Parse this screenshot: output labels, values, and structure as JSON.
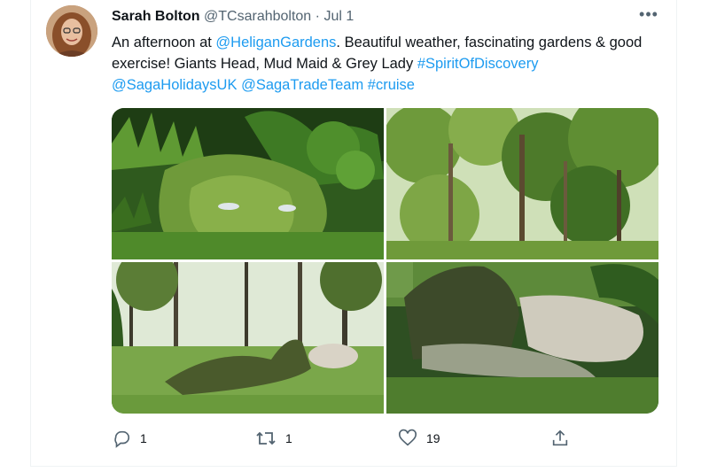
{
  "tweet": {
    "author_name": "Sarah Bolton",
    "author_handle": "@TCsarahbolton",
    "separator": "·",
    "date": "Jul 1",
    "more_label": "•••",
    "text": {
      "part1": "An afternoon at ",
      "mention1": "@HeliganGardens",
      "part2": ". Beautiful weather, fascinating gardens & good exercise! Giants Head, Mud Maid & Grey Lady ",
      "hashtag1": "#SpiritOfDiscovery",
      "space1": " ",
      "mention2": "@SagaHolidaysUK",
      "space2": " ",
      "mention3": "@SagaTradeTeam",
      "space3": " ",
      "hashtag2": "#cruise"
    },
    "media": [
      {
        "subject": "giants-head-sculpture"
      },
      {
        "subject": "woodland-trees"
      },
      {
        "subject": "mud-maid-sculpture"
      },
      {
        "subject": "grey-lady-sculpture-closeup"
      }
    ],
    "actions": {
      "reply_count": "1",
      "retweet_count": "1",
      "like_count": "19"
    }
  },
  "colors": {
    "link": "#1d9bf0",
    "secondary_text": "#536471",
    "primary_text": "#0f1419"
  },
  "icons": [
    "reply-icon",
    "retweet-icon",
    "like-icon",
    "share-icon",
    "more-icon"
  ]
}
